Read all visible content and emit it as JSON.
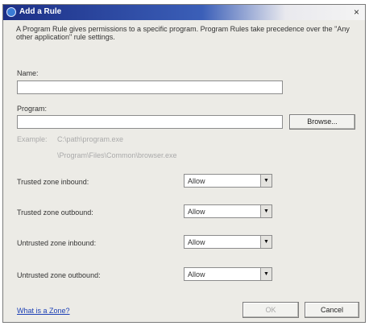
{
  "window": {
    "title": "Add a Rule",
    "close_glyph": "×",
    "icon": "shield-icon"
  },
  "description": "A Program Rule gives permissions to a specific program. Program Rules take precedence over the \"Any other application\" rule settings.",
  "name_field": {
    "label": "Name:",
    "value": "",
    "placeholder": ""
  },
  "program_field": {
    "label": "Program:",
    "value": "",
    "placeholder": ""
  },
  "browse_label": "Browse...",
  "example": {
    "label": "Example:",
    "line1": "C:\\path\\program.exe",
    "line2": "\\Program\\Files\\Common\\browser.exe"
  },
  "zones": [
    {
      "label": "Trusted zone inbound:",
      "value": "Allow"
    },
    {
      "label": "Trusted zone outbound:",
      "value": "Allow"
    },
    {
      "label": "Untrusted zone inbound:",
      "value": "Allow"
    },
    {
      "label": "Untrusted zone outbound:",
      "value": "Allow"
    }
  ],
  "link_text": "What is a Zone?",
  "ok_label": "OK",
  "cancel_label": "Cancel",
  "colors": {
    "title_bar": "#1c2f86",
    "dialog_bg": "#ecebe6",
    "link": "#1b3fb5"
  }
}
